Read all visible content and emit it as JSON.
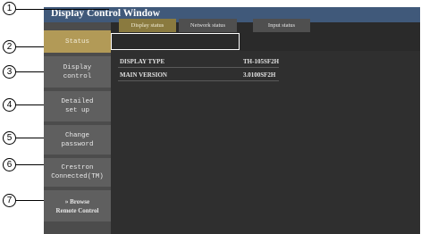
{
  "window": {
    "title": "Display Control Window"
  },
  "sidebar": {
    "items": [
      {
        "label": "Status",
        "active": true
      },
      {
        "label": "Display\ncontrol",
        "active": false
      },
      {
        "label": "Detailed\nset up",
        "active": false
      },
      {
        "label": "Change\npassword",
        "active": false
      },
      {
        "label": "Crestron\nConnected(TM)",
        "active": false
      },
      {
        "label": "» Browse\nRemote Control",
        "active": false
      }
    ]
  },
  "tabs": [
    {
      "label": "Display status",
      "selected": true
    },
    {
      "label": "Network status",
      "selected": false
    },
    {
      "label": "Input status",
      "selected": false
    }
  ],
  "status": {
    "rows": [
      {
        "label": "DISPLAY TYPE",
        "value": "TH-105SF2H"
      },
      {
        "label": "MAIN VERSION",
        "value": "3.0100SF2H"
      }
    ]
  },
  "callouts": [
    "1",
    "2",
    "3",
    "4",
    "5",
    "6",
    "7"
  ]
}
